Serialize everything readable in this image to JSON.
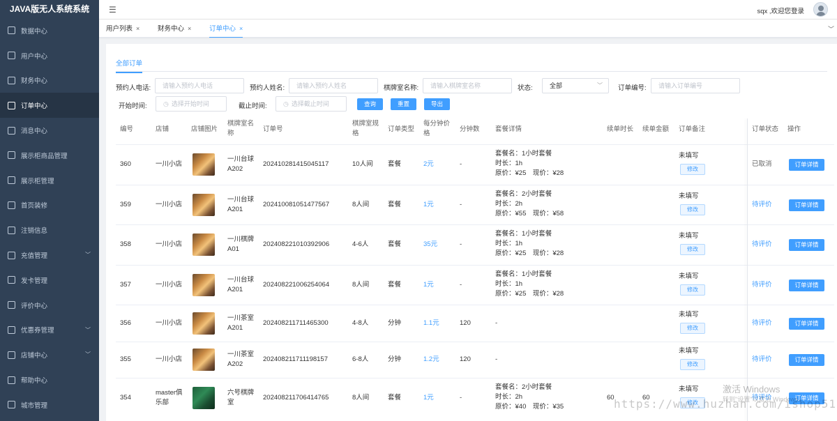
{
  "app": {
    "title": "JAVA版无人系统系统"
  },
  "sidebar": {
    "items": [
      {
        "label": "数据中心",
        "has_arrow": false
      },
      {
        "label": "用户中心",
        "has_arrow": false
      },
      {
        "label": "财务中心",
        "has_arrow": false
      },
      {
        "label": "订单中心",
        "has_arrow": false,
        "active": true
      },
      {
        "label": "消息中心",
        "has_arrow": false
      },
      {
        "label": "展示柜商品管理",
        "has_arrow": false
      },
      {
        "label": "展示柜管理",
        "has_arrow": false
      },
      {
        "label": "首页装修",
        "has_arrow": false
      },
      {
        "label": "注销信息",
        "has_arrow": false
      },
      {
        "label": "充值管理",
        "has_arrow": true
      },
      {
        "label": "发卡管理",
        "has_arrow": false
      },
      {
        "label": "评价中心",
        "has_arrow": false
      },
      {
        "label": "优惠券管理",
        "has_arrow": true
      },
      {
        "label": "店铺中心",
        "has_arrow": true
      },
      {
        "label": "帮助中心",
        "has_arrow": false
      },
      {
        "label": "城市管理",
        "has_arrow": false
      }
    ]
  },
  "header": {
    "menu_icon": "hamburger-icon",
    "welcome": "sqx ,欢迎您登录"
  },
  "tabs": [
    {
      "label": "用户列表",
      "close": "×"
    },
    {
      "label": "财务中心",
      "close": "×"
    },
    {
      "label": "订单中心",
      "close": "×",
      "active": true
    }
  ],
  "tabs_arrow": "﹀",
  "subtab": "全部订单",
  "filters": {
    "phone_label": "预约人电话:",
    "phone_placeholder": "请输入预约人电话",
    "name_label": "预约人姓名:",
    "name_placeholder": "请输入预约人姓名",
    "room_label": "棋牌室名称:",
    "room_placeholder": "请输入棋牌室名称",
    "status_label": "状态:",
    "status_value": "全部",
    "order_label": "订单编号:",
    "order_placeholder": "请输入订单编号",
    "start_label": "开始时间:",
    "start_placeholder": "选择开始时间",
    "end_label": "截止时间:",
    "end_placeholder": "选择截止时间",
    "search": "查询",
    "reset": "重置",
    "export": "导出"
  },
  "table": {
    "headers": {
      "id": "编号",
      "store": "店铺",
      "image": "店铺图片",
      "room_line1": "棋牌室名",
      "room_line2": "称",
      "order": "订单号",
      "spec_line1": "棋牌室规",
      "spec_line2": "格",
      "type": "订单类型",
      "ppm_line1": "每分钟价",
      "ppm_line2": "格",
      "minutes": "分钟数",
      "detail": "套餐详情",
      "renew_time": "续单时长",
      "renew_amount": "续单金额",
      "remark": "订单备注",
      "status": "订单状态",
      "ops": "操作"
    },
    "modify_label": "修改",
    "detail_button": "订单详情",
    "rows": [
      {
        "id": "360",
        "store": "一川小店",
        "room": [
          "一川台球",
          "A202"
        ],
        "order": "2024102814150451​17",
        "spec": "10人间",
        "type": "套餐",
        "price": "2元",
        "minutes": "-",
        "pkg": [
          "套餐名：1小时套餐",
          "时长：1h",
          "原价：¥25　现价：¥28"
        ],
        "renew_time": "",
        "renew_amount": "",
        "remark": "未填写",
        "status": "已取消",
        "status_gray": true
      },
      {
        "id": "359",
        "store": "一川小店",
        "room": [
          "一川台球",
          "A201"
        ],
        "order": "202410081051477567",
        "spec": "8人间",
        "type": "套餐",
        "price": "1元",
        "minutes": "-",
        "pkg": [
          "套餐名：2小时套餐",
          "时长：2h",
          "原价：¥55　现价：¥58"
        ],
        "renew_time": "",
        "renew_amount": "",
        "remark": "未填写",
        "status": "待评价",
        "status_gray": false
      },
      {
        "id": "358",
        "store": "一川小店",
        "room": [
          "一川棋牌",
          "A01"
        ],
        "order": "202408221010392906",
        "spec": "4-6人",
        "type": "套餐",
        "price": "35元",
        "minutes": "-",
        "pkg": [
          "套餐名：1小时套餐",
          "时长：1h",
          "原价：¥25　现价：¥28"
        ],
        "renew_time": "",
        "renew_amount": "",
        "remark": "未填写",
        "status": "待评价",
        "status_gray": false
      },
      {
        "id": "357",
        "store": "一川小店",
        "room": [
          "一川台球",
          "A201"
        ],
        "order": "202408221006254064",
        "spec": "8人间",
        "type": "套餐",
        "price": "1元",
        "minutes": "-",
        "pkg": [
          "套餐名：1小时套餐",
          "时长：1h",
          "原价：¥25　现价：¥28"
        ],
        "renew_time": "",
        "renew_amount": "",
        "remark": "未填写",
        "status": "待评价",
        "status_gray": false
      },
      {
        "id": "356",
        "store": "一川小店",
        "room": [
          "一川茶室",
          "A201"
        ],
        "order": "202408211711465300",
        "spec": "4-8人",
        "type": "分钟",
        "price": "1.1元",
        "minutes": "120",
        "pkg": [
          "-"
        ],
        "renew_time": "",
        "renew_amount": "",
        "remark": "未填写",
        "status": "待评价",
        "status_gray": false
      },
      {
        "id": "355",
        "store": "一川小店",
        "room": [
          "一川茶室",
          "A202"
        ],
        "order": "202408211711198157",
        "spec": "6-8人",
        "type": "分钟",
        "price": "1.2元",
        "minutes": "120",
        "pkg": [
          "-"
        ],
        "renew_time": "",
        "renew_amount": "",
        "remark": "未填写",
        "status": "待评价",
        "status_gray": false
      },
      {
        "id": "354",
        "store": "master俱乐部",
        "room": [
          "六号棋牌",
          "室"
        ],
        "order": "202408211706414765",
        "spec": "8人间",
        "type": "套餐",
        "price": "1元",
        "minutes": "-",
        "pkg": [
          "套餐名：2小时套餐",
          "时长：2h",
          "原价：¥40　现价：¥35"
        ],
        "renew_time": "60",
        "renew_amount": "60",
        "remark": "未填写",
        "status": "待评价",
        "status_gray": false
      }
    ]
  },
  "watermark": {
    "line1": "激活 Windows",
    "line2": "转到\"设置\"以激活 Windows。",
    "url": "https://www.huzhan.com/ishop51679"
  },
  "colors": {
    "sidebar_bg": "#304156",
    "primary": "#409eff"
  }
}
